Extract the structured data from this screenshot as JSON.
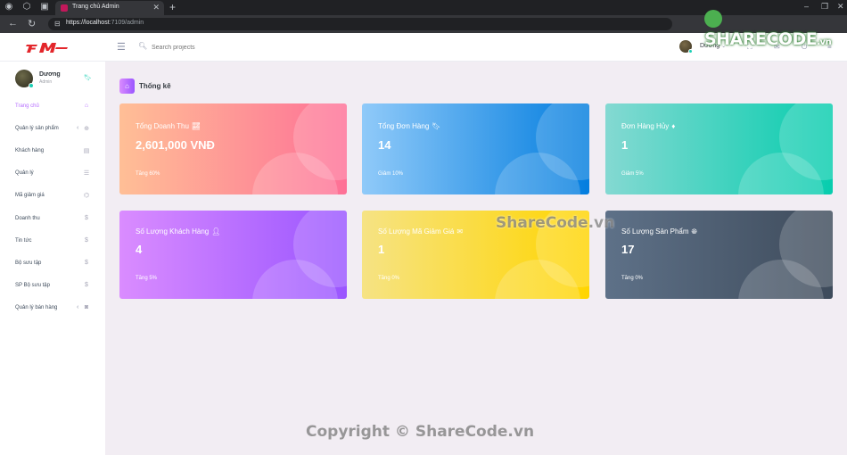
{
  "browser": {
    "tab_title": "Trang chủ Admin",
    "url_host": "https://localhost",
    "url_path": ":7109/admin"
  },
  "header": {
    "search_placeholder": "Search projects",
    "user_name": "Dương"
  },
  "sidebar": {
    "profile": {
      "name": "Dương",
      "role": "Admin"
    },
    "items": [
      {
        "label": "Trang chủ",
        "icon": "home-icon",
        "active": true
      },
      {
        "label": "Quản lý sản phẩm",
        "icon": "crosshair-icon",
        "has_chevron": true
      },
      {
        "label": "Khách hàng",
        "icon": "contacts-icon"
      },
      {
        "label": "Quản lý",
        "icon": "list-icon"
      },
      {
        "label": "Mã giảm giá",
        "icon": "tags-icon"
      },
      {
        "label": "Doanh thu",
        "icon": "dollar-icon"
      },
      {
        "label": "Tin tức",
        "icon": "dollar-icon"
      },
      {
        "label": "Bộ sưu tập",
        "icon": "dollar-icon"
      },
      {
        "label": "SP Bộ sưu tập",
        "icon": "dollar-icon"
      },
      {
        "label": "Quản lý bán hàng",
        "icon": "camera-icon",
        "has_chevron": true
      }
    ]
  },
  "page": {
    "title": "Thống kê",
    "icon": "home-icon"
  },
  "cards": [
    {
      "title": "Tổng Doanh Thu",
      "icon": "chart-line-icon",
      "value": "2,601,000 VNĐ",
      "sub": "Tăng 60%",
      "color_from": "#ffbf96",
      "color_to": "#fe7096"
    },
    {
      "title": "Tổng Đơn Hàng",
      "icon": "bookmark-icon",
      "value": "14",
      "sub": "Giảm 10%",
      "color_from": "#90caf9",
      "color_to": "#047edf"
    },
    {
      "title": "Đơn Hàng Hủy",
      "icon": "diamond-icon",
      "value": "1",
      "sub": "Giảm 5%",
      "color_from": "#84d9d2",
      "color_to": "#07cdae"
    },
    {
      "title": "Số Lượng Khách Hàng",
      "icon": "user-icon",
      "value": "4",
      "sub": "Tăng 5%",
      "color_from": "#da8cff",
      "color_to": "#9a55ff"
    },
    {
      "title": "Số Lượng Mã Giảm Giá",
      "icon": "mail-icon",
      "value": "1",
      "sub": "Tăng 0%",
      "color_from": "#f6e384",
      "color_to": "#ffd500"
    },
    {
      "title": "Số Lượng Sản Phẩm",
      "icon": "globe-icon",
      "value": "17",
      "sub": "Tăng 0%",
      "color_from": "#5e7188",
      "color_to": "#3e4b5b"
    }
  ],
  "watermarks": {
    "logo": "SHARECODE",
    "logo_suffix": ".vn",
    "middle": "ShareCode.vn",
    "bottom": "Copyright © ShareCode.vn"
  }
}
